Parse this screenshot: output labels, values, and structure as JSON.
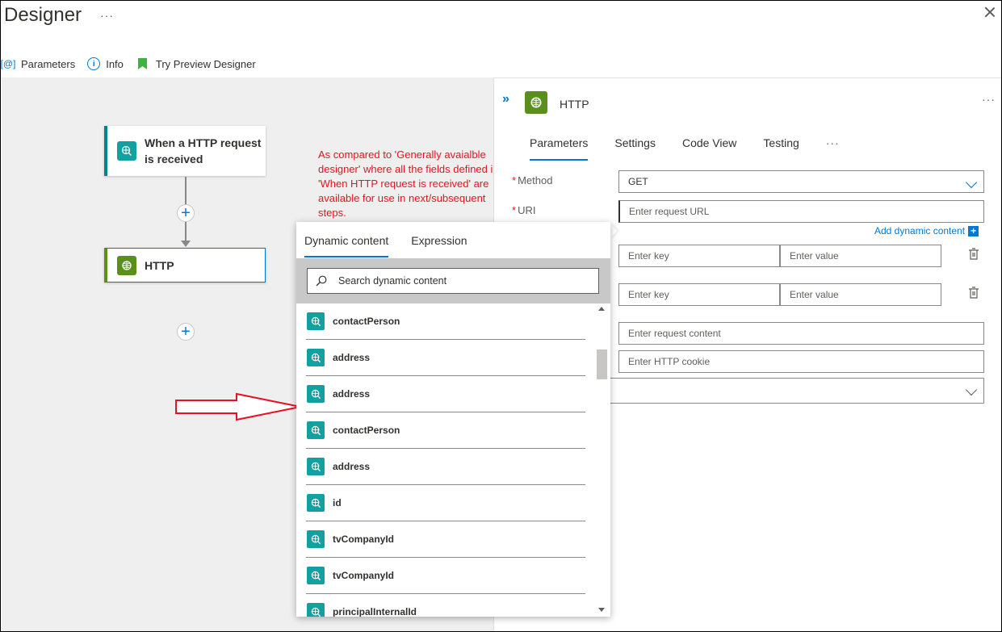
{
  "header": {
    "title": "Designer",
    "more": "···"
  },
  "toolbar": {
    "parameters_label": "Parameters",
    "parameters_icon": "parameters-icon",
    "info_label": "Info",
    "info_icon": "info-icon",
    "preview_label": "Try Preview Designer",
    "preview_icon": "bookmark-icon"
  },
  "canvas": {
    "trigger_card": {
      "title": "When a HTTP request is received",
      "icon": "http-request-icon"
    },
    "http_card": {
      "title": "HTTP",
      "icon": "http-icon"
    },
    "add_glyph": "+"
  },
  "annotation": {
    "text": "As compared to 'Generally avaialble designer' where all the fields defined in 'When HTTP request is received' are available for use in next/subsequent steps."
  },
  "panel": {
    "collapse": "»",
    "title": "HTTP",
    "more": "···",
    "tabs": [
      {
        "label": "Parameters",
        "active": true
      },
      {
        "label": "Settings",
        "active": false
      },
      {
        "label": "Code View",
        "active": false
      },
      {
        "label": "Testing",
        "active": false
      }
    ],
    "tab_more": "···",
    "method": {
      "label": "Method",
      "value": "GET"
    },
    "uri": {
      "label": "URI",
      "placeholder": "Enter request URL"
    },
    "add_dynamic": "Add dynamic content",
    "add_dynamic_glyph": "+",
    "headers": {
      "key_placeholder": "Enter key",
      "value_placeholder": "Enter value"
    },
    "queries": {
      "key_placeholder": "Enter key",
      "value_placeholder": "Enter value"
    },
    "body": {
      "placeholder": "Enter request content"
    },
    "cookie": {
      "placeholder": "Enter HTTP cookie"
    }
  },
  "dynamic_content": {
    "tabs": [
      {
        "label": "Dynamic content",
        "active": true
      },
      {
        "label": "Expression",
        "active": false
      }
    ],
    "search_placeholder": "Search dynamic content",
    "items": [
      "contactPerson",
      "address",
      "address",
      "contactPerson",
      "address",
      "id",
      "tvCompanyId",
      "tvCompanyId",
      "principalInternalId"
    ]
  },
  "colors": {
    "accent": "#0078d4",
    "trigger_teal": "#13a0a0",
    "http_green": "#5a8f1e",
    "annotation_red": "#e81123"
  }
}
